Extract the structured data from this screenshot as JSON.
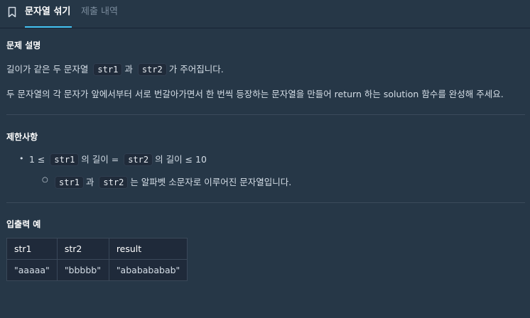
{
  "tabs": {
    "active": "문자열 섞기",
    "inactive": "제출 내역"
  },
  "problem": {
    "heading": "문제 설명",
    "line1": {
      "prefix": "길이가 같은 두 문자열",
      "code1": "str1",
      "mid": "과",
      "code2": "str2",
      "suffix": "가 주어집니다."
    },
    "line2": "두 문자열의 각 문자가 앞에서부터 서로 번갈아가면서 한 번씩 등장하는 문자열을 만들어 return 하는 solution 함수를 완성해 주세요."
  },
  "constraints": {
    "heading": "제한사항",
    "item1": {
      "prefix": "1 ≤",
      "code1": "str1",
      "mid1": "의 길이 =",
      "code2": "str2",
      "suffix": "의 길이 ≤ 10"
    },
    "item2": {
      "code1": "str1",
      "mid": "과",
      "code2": "str2",
      "suffix": "는 알파벳 소문자로 이루어진 문자열입니다."
    }
  },
  "io": {
    "heading": "입출력 예",
    "columns": [
      "str1",
      "str2",
      "result"
    ],
    "rows": [
      [
        "\"aaaaa\"",
        "\"bbbbb\"",
        "\"ababababab\""
      ]
    ]
  }
}
